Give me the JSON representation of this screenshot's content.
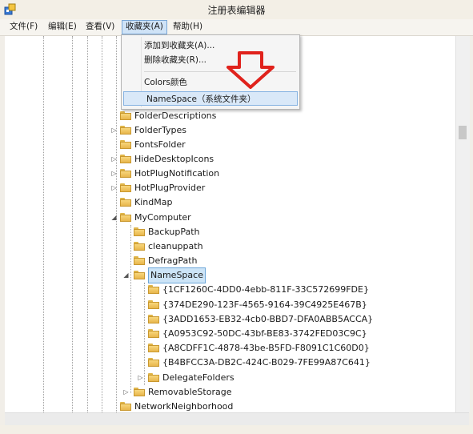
{
  "window": {
    "title": "注册表编辑器",
    "icon": "regedit-icon"
  },
  "menubar": [
    {
      "label": "文件(F)"
    },
    {
      "label": "编辑(E)"
    },
    {
      "label": "查看(V)"
    },
    {
      "label": "收藏夹(A)",
      "active": true
    },
    {
      "label": "帮助(H)"
    }
  ],
  "favorites_menu": {
    "items": [
      {
        "label": "添加到收藏夹(A)..."
      },
      {
        "label": "删除收藏夹(R)..."
      },
      {
        "label": "Colors颜色"
      },
      {
        "label": "NameSpace（系统文件夹）",
        "highlighted": true
      }
    ],
    "annotation_icon": "red-down-arrow-icon"
  },
  "tree": {
    "items": [
      {
        "label": "FolderDescriptions"
      },
      {
        "label": "FolderTypes"
      },
      {
        "label": "FontsFolder"
      },
      {
        "label": "HideDesktopIcons"
      },
      {
        "label": "HotPlugNotification"
      },
      {
        "label": "HotPlugProvider"
      },
      {
        "label": "KindMap"
      },
      {
        "label": "MyComputer"
      },
      {
        "label": "BackupPath"
      },
      {
        "label": "cleanuppath"
      },
      {
        "label": "DefragPath"
      },
      {
        "label": "NameSpace",
        "selected": true
      },
      {
        "label": "{1CF1260C-4DD0-4ebb-811F-33C572699FDE}"
      },
      {
        "label": "{374DE290-123F-4565-9164-39C4925E467B}"
      },
      {
        "label": "{3ADD1653-EB32-4cb0-BBD7-DFA0ABB5ACCA}"
      },
      {
        "label": "{A0953C92-50DC-43bf-BE83-3742FED03C9C}"
      },
      {
        "label": "{A8CDFF1C-4878-43be-B5FD-F8091C1C60D0}"
      },
      {
        "label": "{B4BFCC3A-DB2C-424C-B029-7FE99A87C641}"
      },
      {
        "label": "DelegateFolders"
      },
      {
        "label": "RemovableStorage"
      },
      {
        "label": "NetworkNeighborhood"
      }
    ]
  },
  "colors": {
    "selection": "#cce4f7",
    "arrow": "#e0221c",
    "folder": "#f0c65c"
  }
}
